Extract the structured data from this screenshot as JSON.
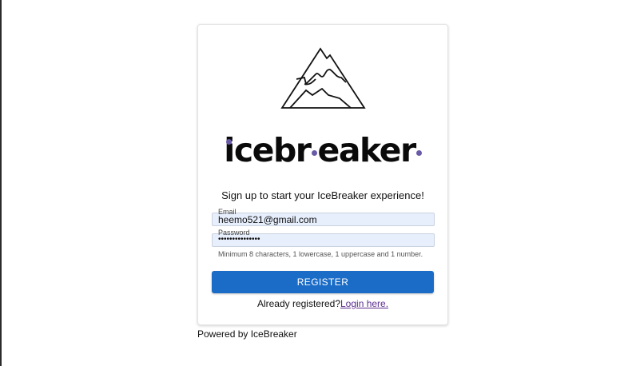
{
  "brand": {
    "logo_icon": "mountain-icon",
    "wordmark_parts": [
      "icebr",
      "eaker"
    ],
    "dot_color": "#6a5ba8"
  },
  "form": {
    "tagline": "Sign up to start your IceBreaker experience!",
    "email": {
      "label": "Email",
      "value": "heemo521@gmail.com"
    },
    "password": {
      "label": "Password",
      "masked_value": "•••••••••••••••"
    },
    "password_hint": "Minimum 8 characters, 1 lowercase, 1 uppercase and 1 number.",
    "register_label": "REGISTER",
    "already_text": "Already registered?",
    "login_link": "Login here."
  },
  "footer": {
    "powered_by": "Powered by IceBreaker"
  },
  "colors": {
    "primary_button": "#1b6cc7",
    "input_fill": "#e7effd",
    "link_visited": "#5b2d8e"
  }
}
